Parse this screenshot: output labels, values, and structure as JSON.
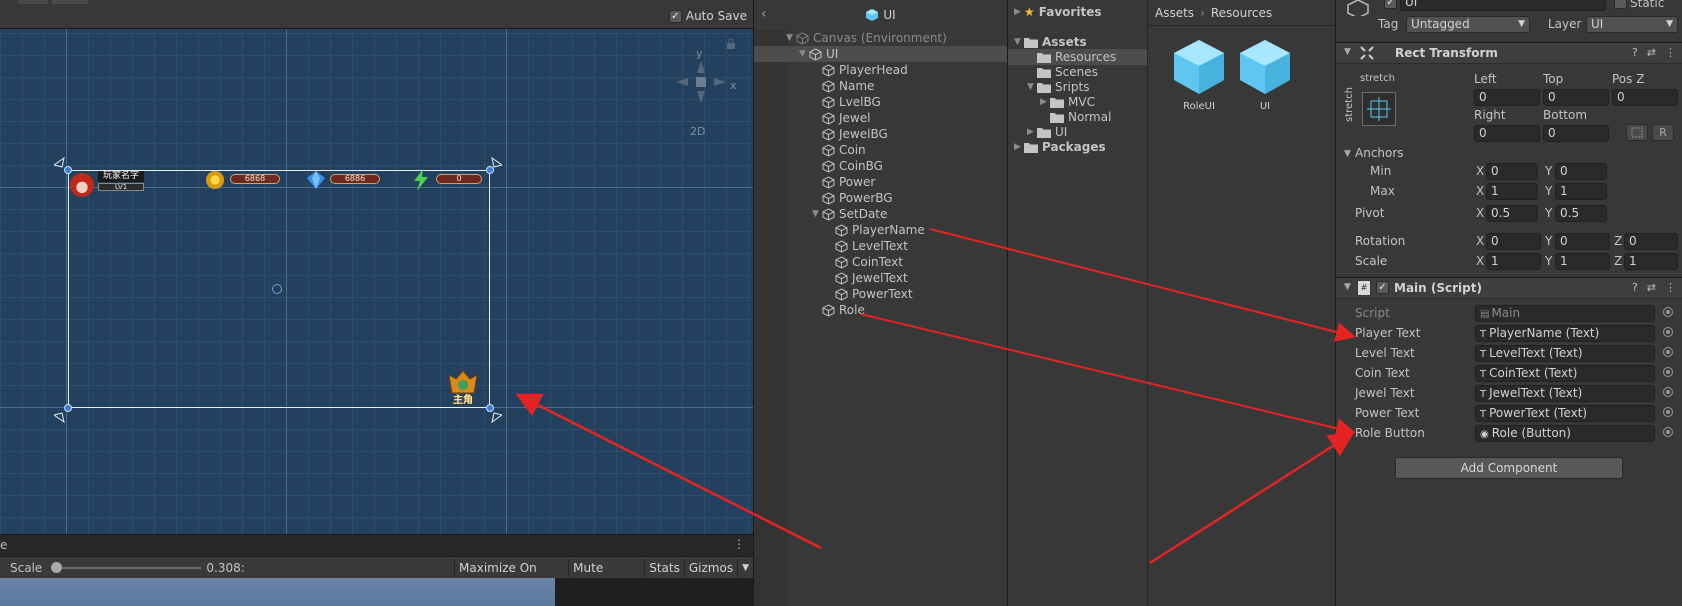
{
  "scene": {
    "auto_save_label": "Auto Save",
    "auto_save_checked": true,
    "gizmo_axes": {
      "y": "y",
      "x": "x"
    },
    "mode_2d": "2D",
    "hud": {
      "player_name": "玩家名字",
      "level": "LV1",
      "coin": "6868",
      "jewel": "6886",
      "power": "0",
      "role_label": "主角"
    }
  },
  "game_toolbar": {
    "scale_label": "Scale",
    "scale_value": "0.308:",
    "scale_fraction": 0.0,
    "maximize": "Maximize On Play",
    "mute": "Mute Audio",
    "stats": "Stats",
    "gizmos": "Gizmos"
  },
  "hierarchy": {
    "title": "UI",
    "items": [
      {
        "label": "Canvas (Environment)",
        "depth": 0,
        "fold": "▼",
        "dim": true
      },
      {
        "label": "UI",
        "depth": 1,
        "fold": "▼",
        "selected": true
      },
      {
        "label": "PlayerHead",
        "depth": 2,
        "fold": ""
      },
      {
        "label": "Name",
        "depth": 2,
        "fold": ""
      },
      {
        "label": "LvelBG",
        "depth": 2,
        "fold": ""
      },
      {
        "label": "Jewel",
        "depth": 2,
        "fold": ""
      },
      {
        "label": "JewelBG",
        "depth": 2,
        "fold": ""
      },
      {
        "label": "Coin",
        "depth": 2,
        "fold": ""
      },
      {
        "label": "CoinBG",
        "depth": 2,
        "fold": ""
      },
      {
        "label": "Power",
        "depth": 2,
        "fold": ""
      },
      {
        "label": "PowerBG",
        "depth": 2,
        "fold": ""
      },
      {
        "label": "SetDate",
        "depth": 2,
        "fold": "▼"
      },
      {
        "label": "PlayerName",
        "depth": 3,
        "fold": ""
      },
      {
        "label": "LevelText",
        "depth": 3,
        "fold": ""
      },
      {
        "label": "CoinText",
        "depth": 3,
        "fold": ""
      },
      {
        "label": "JewelText",
        "depth": 3,
        "fold": ""
      },
      {
        "label": "PowerText",
        "depth": 3,
        "fold": ""
      },
      {
        "label": "Role",
        "depth": 2,
        "fold": ""
      }
    ]
  },
  "project": {
    "favorites": "Favorites",
    "tree": [
      {
        "label": "Assets",
        "depth": 0,
        "fold": "▼",
        "bold": true
      },
      {
        "label": "Resources",
        "depth": 1,
        "fold": "",
        "selected": true
      },
      {
        "label": "Scenes",
        "depth": 1,
        "fold": ""
      },
      {
        "label": "Sripts",
        "depth": 1,
        "fold": "▼"
      },
      {
        "label": "MVC",
        "depth": 2,
        "fold": "▶"
      },
      {
        "label": "Normal",
        "depth": 2,
        "fold": ""
      },
      {
        "label": "UI",
        "depth": 1,
        "fold": "▶"
      },
      {
        "label": "Packages",
        "depth": 0,
        "fold": "▶",
        "bold": true
      }
    ],
    "breadcrumb": [
      "Assets",
      "Resources"
    ],
    "assets": [
      "RoleUI",
      "UI"
    ]
  },
  "inspector": {
    "object_name": "UI",
    "static_label": "Static",
    "tag_label": "Tag",
    "tag_value": "Untagged",
    "layer_label": "Layer",
    "layer_value": "UI",
    "rect_transform": {
      "title": "Rect Transform",
      "anchor_preset_h": "stretch",
      "anchor_preset_v": "stretch",
      "left_label": "Left",
      "left": "0",
      "top_label": "Top",
      "top": "0",
      "posz_label": "Pos Z",
      "posz": "0",
      "right_label": "Right",
      "right": "0",
      "bottom_label": "Bottom",
      "bottom": "0",
      "r_button": "R",
      "anchors_label": "Anchors",
      "min_label": "Min",
      "min_x": "0",
      "min_y": "0",
      "max_label": "Max",
      "max_x": "1",
      "max_y": "1",
      "pivot_label": "Pivot",
      "pivot_x": "0.5",
      "pivot_y": "0.5",
      "rotation_label": "Rotation",
      "rot_x": "0",
      "rot_y": "0",
      "rot_z": "0",
      "scale_label": "Scale",
      "scale_x": "1",
      "scale_y": "1",
      "scale_z": "1",
      "x": "X",
      "y": "Y",
      "z": "Z"
    },
    "main_script": {
      "title": "Main (Script)",
      "script_label": "Script",
      "script_value": "Main",
      "fields": [
        {
          "label": "Player Text",
          "value": "PlayerName (Text)",
          "icon": "T"
        },
        {
          "label": "Level Text",
          "value": "LevelText (Text)",
          "icon": "T"
        },
        {
          "label": "Coin Text",
          "value": "CoinText (Text)",
          "icon": "T"
        },
        {
          "label": "Jewel Text",
          "value": "JewelText (Text)",
          "icon": "T"
        },
        {
          "label": "Power Text",
          "value": "PowerText (Text)",
          "icon": "T"
        },
        {
          "label": "Role Button",
          "value": "Role (Button)",
          "icon": "◉"
        }
      ]
    },
    "add_component": "Add Component"
  },
  "colors": {
    "scene_bg": "#23415f",
    "panel_bg": "#383838",
    "accent_cube": "#5ec6f0",
    "arrow": "#e52323"
  }
}
